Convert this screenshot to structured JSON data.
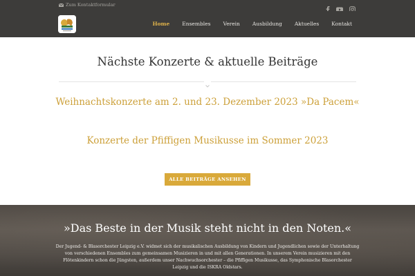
{
  "topbar": {
    "contact_label": "Zum Kontaktformular",
    "socials": [
      {
        "icon": "facebook-icon"
      },
      {
        "icon": "youtube-icon"
      },
      {
        "icon": "instagram-icon"
      }
    ]
  },
  "header": {
    "logo_icon": "orchestra-logo",
    "nav": [
      {
        "label": "Home",
        "active": true
      },
      {
        "label": "Ensembles",
        "active": false
      },
      {
        "label": "Verein",
        "active": false
      },
      {
        "label": "Ausbildung",
        "active": false
      },
      {
        "label": "Aktuelles",
        "active": false
      },
      {
        "label": "Kontakt",
        "active": false
      }
    ]
  },
  "main": {
    "title": "Nächste Konzerte & aktuelle Beiträge",
    "posts": [
      {
        "title": "Weihnachtskonzerte am 2. und 23. Dezember 2023 »Da Pacem«"
      },
      {
        "title": "Konzerte der Pfiffigen Musikusse im Sommer 2023"
      }
    ],
    "all_posts_button": "ALLE BEITRÄGE ANSEHEN"
  },
  "hero": {
    "quote": "»Das Beste in der Musik steht nicht in den Noten.«",
    "description": "Der Jugend- & Blasorchester Leipzig e.V. widmet sich der musikalischen Ausbildung von Kindern und Jugendlichen sowie der Unterhaltung von verschiedenen Ensembles zum gemeinsamen Musizieren in und mit allen Generationen. In unserem Verein musizieren mit den Flötenkindern schon die Jüngsten, außerdem unser Nachwuchsorchester – die Pfiffigen Musikusse, das Symphonische Blasorchester Leipzig und die ISKRA Oldstars."
  },
  "colors": {
    "accent": "#d9a93a",
    "header_bg": "#3d3c3a",
    "post_link": "#cca039"
  }
}
